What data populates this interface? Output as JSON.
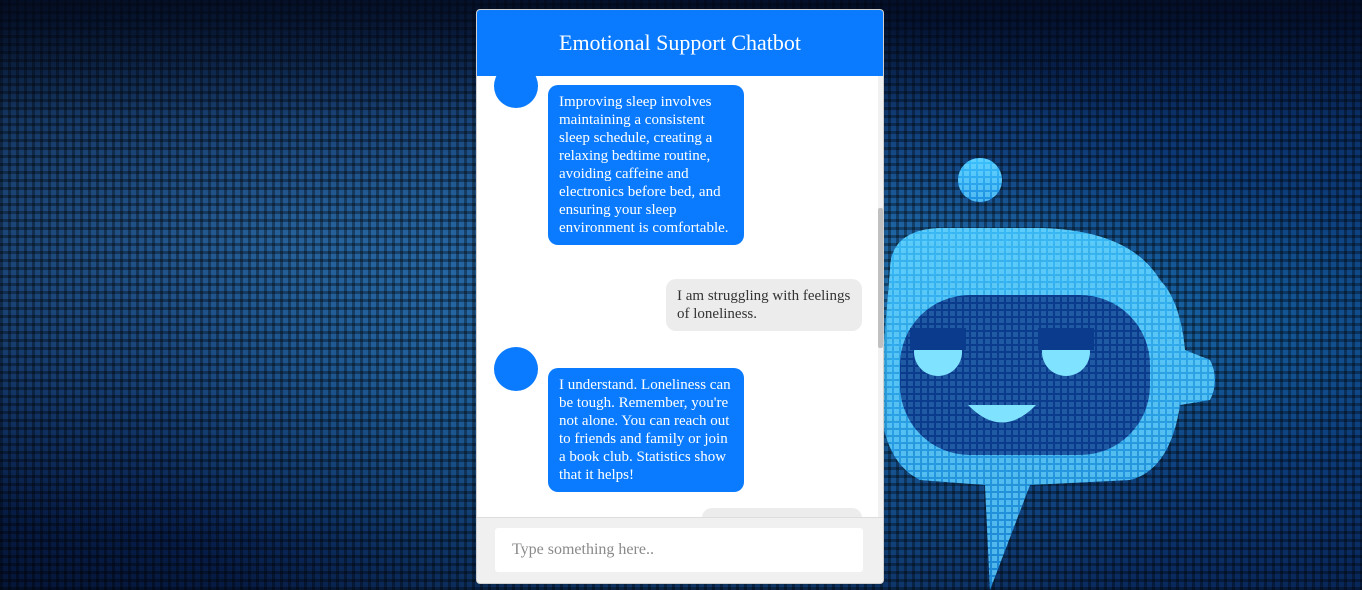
{
  "colors": {
    "accent": "#0a7bff",
    "user_bubble": "#ececec",
    "input_bar": "#f0f0f0"
  },
  "header": {
    "title": "Emotional Support Chatbot"
  },
  "messages": [
    {
      "sender": "bot",
      "text": "Improving sleep involves maintaining a consistent sleep schedule, creating a relaxing bedtime routine, avoiding caffeine and electronics before bed, and ensuring your sleep environment is comfortable."
    },
    {
      "sender": "user",
      "text": "I am struggling with feelings of loneliness."
    },
    {
      "sender": "bot",
      "text": "I understand. Loneliness can be tough. Remember, you're not alone. You can reach out to friends and family or join a book club. Statistics show that it helps!"
    },
    {
      "sender": "user",
      "text": ""
    }
  ],
  "input": {
    "placeholder": "Type something here..",
    "value": ""
  },
  "background": {
    "icon": "robot-chat-bubble-icon"
  }
}
